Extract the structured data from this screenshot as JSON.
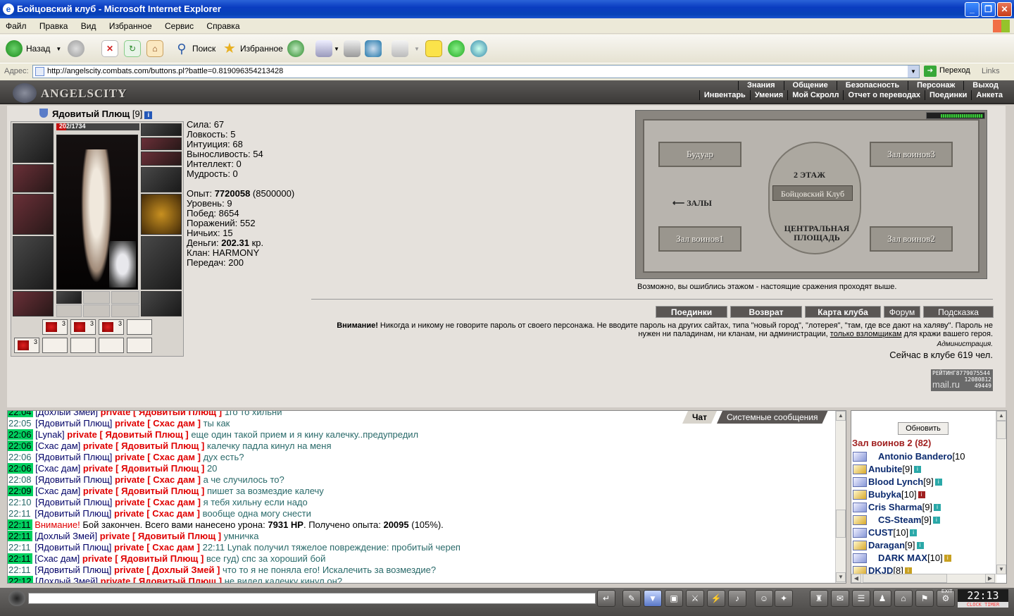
{
  "window": {
    "title": "Бойцовский клуб - Microsoft Internet Explorer"
  },
  "menu": [
    "Файл",
    "Правка",
    "Вид",
    "Избранное",
    "Сервис",
    "Справка"
  ],
  "toolbar": {
    "back": "Назад",
    "search": "Поиск",
    "favorites": "Избранное"
  },
  "address": {
    "label": "Адрес:",
    "url": "http://angelscity.combats.com/buttons.pl?battle=0.819096354213428",
    "go": "Переход",
    "links": "Links"
  },
  "site": {
    "logo": "ANGELSCITY",
    "nav_top": [
      "Знания",
      "Общение",
      "Безопасность",
      "Персонаж",
      "Выход"
    ],
    "nav_bottom": [
      "Инвентарь",
      "Умения",
      "Мой Скролл",
      "Отчет о переводах",
      "Поединки",
      "Анкета"
    ]
  },
  "character": {
    "name": "Ядовитый Плющ",
    "level": "[9]",
    "hp": "202/1734",
    "hp_fraction": 0.1165,
    "potions": [
      "3",
      "3",
      "3",
      "3"
    ],
    "stats": [
      {
        "label": "Сила: ",
        "value": "67"
      },
      {
        "label": "Ловкость: ",
        "value": "5"
      },
      {
        "label": "Интуиция: ",
        "value": "68"
      },
      {
        "label": "Выносливость: ",
        "value": "54"
      },
      {
        "label": "Интеллект: ",
        "value": "0"
      },
      {
        "label": "Мудрость: ",
        "value": "0"
      }
    ],
    "exp_label": "Опыт: ",
    "exp_value": "7720058",
    "exp_next": " (8500000)",
    "info": [
      {
        "label": "Уровень: ",
        "value": "9"
      },
      {
        "label": "Побед: ",
        "value": "8654"
      },
      {
        "label": "Поражений: ",
        "value": "552"
      },
      {
        "label": "Ничьих: ",
        "value": "15"
      }
    ],
    "money_label": "Деньги: ",
    "money_value": "202.31",
    "money_unit": " кр.",
    "clan": "Клан: HARMONY",
    "transfers": "Передач: 200"
  },
  "map": {
    "rooms": [
      "Будуар",
      "Зал воинов3",
      "Зал воинов1",
      "Зал воинов2"
    ],
    "floor": "2 ЭТАЖ",
    "club": "Бойцовский Клуб",
    "exit": "⟵ ЗАЛЫ",
    "square": "ЦЕНТРАЛЬНАЯ ПЛОЩАДЬ",
    "note": "Возможно, вы ошиблись этажом - настоящие сражения проходят выше."
  },
  "actions": [
    "Поединки",
    "Возврат",
    "Карта клуба",
    "Форум",
    "Подсказка"
  ],
  "warning": {
    "bold": "Внимание!",
    "text": " Никогда и никому не говорите пароль от своего персонажа. Не вводите пароль на других сайтах, типа \"новый город\", \"лотерея\", \"там, где все дают на халяву\". Пароль не нужен ни паладинам, ни кланам, ни администрации, ",
    "underlined": "только взломщикам",
    "tail": " для кражи вашего героя.",
    "admin": "Администрация.",
    "online": "Сейчас в клубе 619 чел."
  },
  "counter": {
    "label": "РЕЙТИНГ",
    "n1": "8779075544",
    "n2": "12080812",
    "n3": "49449",
    "brand": "mail.ru"
  },
  "chat": {
    "tabs": [
      "Чат",
      "Системные сообщения"
    ],
    "lines": [
      {
        "time": "22:04",
        "hl": true,
        "from": "Дохлый Змей",
        "to": "Ядовитый Плющ",
        "msg": "1го то хильни"
      },
      {
        "time": "22:05",
        "hl": false,
        "from": "Ядовитый Плющ",
        "to": "Схас дам",
        "msg": "ты как"
      },
      {
        "time": "22:06",
        "hl": true,
        "from": "Lynak",
        "to": "Ядовитый Плющ",
        "msg": "еще один такой прием и я кину калечку..предупредил"
      },
      {
        "time": "22:06",
        "hl": true,
        "from": "Схас дам",
        "to": "Ядовитый Плющ",
        "msg": "калечку падла кинул на меня"
      },
      {
        "time": "22:06",
        "hl": false,
        "from": "Ядовитый Плющ",
        "to": "Схас дам",
        "msg": "дух есть?"
      },
      {
        "time": "22:06",
        "hl": true,
        "from": "Схас дам",
        "to": "Ядовитый Плющ",
        "msg": "20"
      },
      {
        "time": "22:08",
        "hl": false,
        "from": "Ядовитый Плющ",
        "to": "Схас дам",
        "msg": "а че случилось то?"
      },
      {
        "time": "22:09",
        "hl": true,
        "from": "Схас дам",
        "to": "Ядовитый Плющ",
        "msg": "пишет за возмездие калечу"
      },
      {
        "time": "22:10",
        "hl": false,
        "from": "Ядовитый Плющ",
        "to": "Схас дам",
        "msg": "я тебя хильну если надо"
      },
      {
        "time": "22:11",
        "hl": false,
        "from": "Ядовитый Плющ",
        "to": "Схас дам",
        "msg": "вообще одна могу снести"
      },
      {
        "time": "22:11",
        "hl": true,
        "system": true,
        "warn": "Внимание!",
        "pre": " Бой закончен. Всего вами нанесено урона: ",
        "dmg": "7931 HP",
        "mid": ". Получено опыта: ",
        "exp": "20095",
        "post": " (105%)."
      },
      {
        "time": "22:11",
        "hl": true,
        "from": "Дохлый Змей",
        "to": "Ядовитый Плющ",
        "msg": "умничка"
      },
      {
        "time": "22:11",
        "hl": false,
        "from": "Ядовитый Плющ",
        "to": "Схас дам",
        "msg": "22:11 Lynak получил тяжелое повреждение: пробитый череп"
      },
      {
        "time": "22:11",
        "hl": true,
        "from": "Схас дам",
        "to": "Ядовитый Плющ",
        "msg": "все гуд) спс за хороший бой"
      },
      {
        "time": "22:11",
        "hl": false,
        "from": "Ядовитый Плющ",
        "to": "Дохлый Змей",
        "msg": "что то я не поняла его! Искалечить за возмездие?"
      },
      {
        "time": "22:12",
        "hl": true,
        "from": "Дохлый Змей",
        "to": "Ядовитый Плющ",
        "msg": "не видел.калечку кинул он?"
      }
    ],
    "private_word": "private"
  },
  "users": {
    "refresh": "Обновить",
    "room": "Зал воинов 2 (82)",
    "list": [
      {
        "name": "Antonio Bandero",
        "lvl": "[10",
        "info": "",
        "prefix": true
      },
      {
        "name": "Anubite",
        "lvl": "[9]",
        "info": "i"
      },
      {
        "name": "Blood Lynch",
        "lvl": "[9]",
        "info": "i"
      },
      {
        "name": "Bubyka",
        "lvl": "[10]",
        "info": "i",
        "red": true
      },
      {
        "name": "Cris Sharma",
        "lvl": "[9]",
        "info": "i"
      },
      {
        "name": "CS-Steam",
        "lvl": "[9]",
        "info": "i",
        "prefix": true
      },
      {
        "name": "CUST",
        "lvl": "[10]",
        "info": "i"
      },
      {
        "name": "Daragan",
        "lvl": "[9]",
        "info": "i"
      },
      {
        "name": "DARK MAX",
        "lvl": "[10]",
        "info": "i",
        "prefix": true,
        "yellow": true
      },
      {
        "name": "DKJD",
        "lvl": "[8]",
        "info": "i",
        "yellow": true
      }
    ]
  },
  "clock": {
    "time": "22:13",
    "sub": "CLOCK TIMER",
    "exit": "EXIT"
  }
}
